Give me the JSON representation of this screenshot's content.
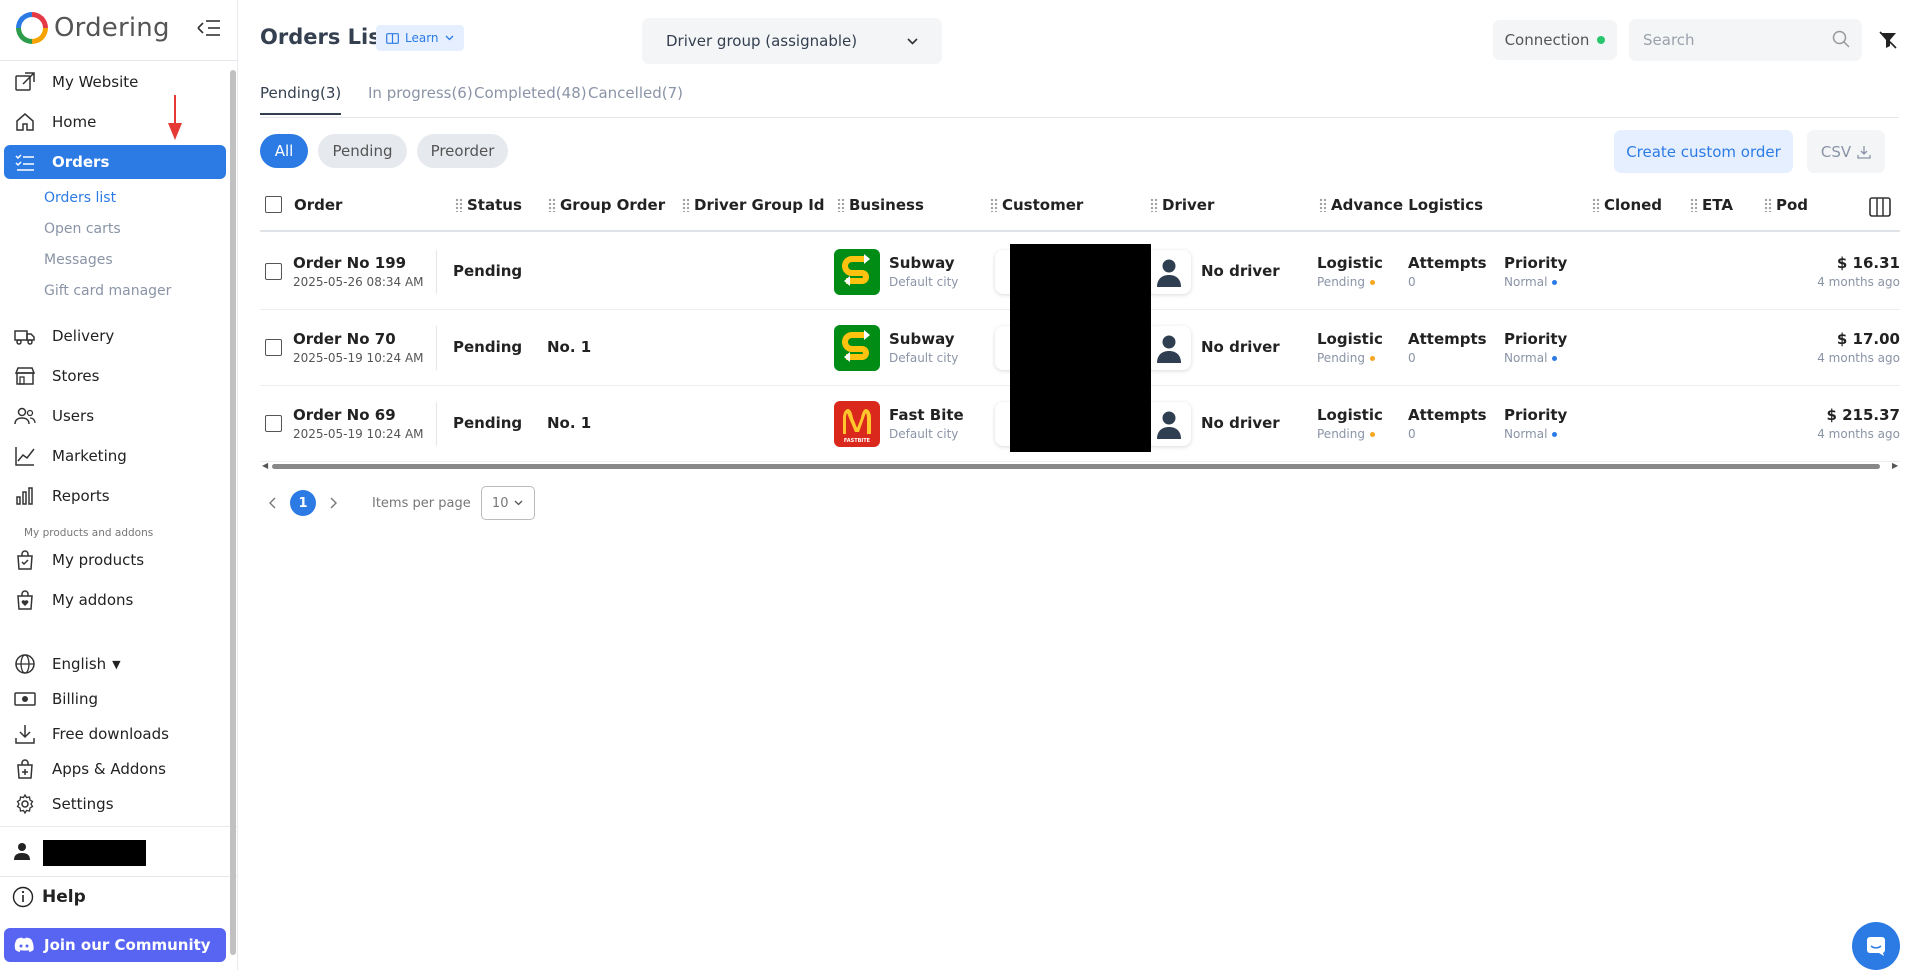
{
  "brand": {
    "name": "Ordering"
  },
  "sidebar": {
    "items": [
      {
        "label": "My Website",
        "icon": "external-link-icon"
      },
      {
        "label": "Home",
        "icon": "home-icon"
      },
      {
        "label": "Orders",
        "icon": "list-icon",
        "active": true
      },
      {
        "label": "Delivery",
        "icon": "truck-icon"
      },
      {
        "label": "Stores",
        "icon": "store-icon"
      },
      {
        "label": "Users",
        "icon": "users-icon"
      },
      {
        "label": "Marketing",
        "icon": "chart-line-icon"
      },
      {
        "label": "Reports",
        "icon": "bar-chart-icon"
      }
    ],
    "sub_items": [
      "Orders list",
      "Open carts",
      "Messages",
      "Gift card manager"
    ],
    "section_label": "My products and addons",
    "product_items": [
      {
        "label": "My products",
        "icon": "bag-check-icon"
      },
      {
        "label": "My addons",
        "icon": "bag-heart-icon"
      }
    ],
    "language": "English",
    "bottom_items": [
      {
        "label": "Billing",
        "icon": "cash-icon"
      },
      {
        "label": "Free downloads",
        "icon": "download-icon"
      },
      {
        "label": "Apps & Addons",
        "icon": "bag-plus-icon"
      },
      {
        "label": "Settings",
        "icon": "gear-icon"
      }
    ],
    "help": "Help",
    "community": "Join our Community"
  },
  "header": {
    "title": "Orders List",
    "learn": "Learn",
    "driver_group": "Driver group (assignable)",
    "connection": "Connection",
    "search_placeholder": "Search"
  },
  "tabs": [
    "Pending(3)",
    "In progress(6)",
    "Completed(48)",
    "Cancelled(7)"
  ],
  "filters": [
    "All",
    "Pending",
    "Preorder"
  ],
  "actions": {
    "create": "Create custom order",
    "csv": "CSV"
  },
  "table": {
    "columns": [
      "Order",
      "Status",
      "Group Order",
      "Driver Group Id",
      "Business",
      "Customer",
      "Driver",
      "Advance Logistics",
      "Cloned",
      "ETA",
      "Pod"
    ],
    "rows": [
      {
        "order": "Order No 199",
        "date": "2025-05-26 08:34 AM",
        "status": "Pending",
        "group": "",
        "business": "Subway",
        "city": "Default city",
        "driver": "No driver",
        "logistic": "Logistic",
        "logistic_status": "Pending",
        "attempts": "Attempts",
        "attempts_count": "0",
        "priority": "Priority",
        "priority_level": "Normal",
        "price": "$ 16.31",
        "ago": "4 months ago",
        "logo": "subway"
      },
      {
        "order": "Order No 70",
        "date": "2025-05-19 10:24 AM",
        "status": "Pending",
        "group": "No. 1",
        "business": "Subway",
        "city": "Default city",
        "driver": "No driver",
        "logistic": "Logistic",
        "logistic_status": "Pending",
        "attempts": "Attempts",
        "attempts_count": "0",
        "priority": "Priority",
        "priority_level": "Normal",
        "price": "$ 17.00",
        "ago": "4 months ago",
        "logo": "subway"
      },
      {
        "order": "Order No 69",
        "date": "2025-05-19 10:24 AM",
        "status": "Pending",
        "group": "No. 1",
        "business": "Fast Bite",
        "city": "Default city",
        "driver": "No driver",
        "logistic": "Logistic",
        "logistic_status": "Pending",
        "attempts": "Attempts",
        "attempts_count": "0",
        "priority": "Priority",
        "priority_level": "Normal",
        "price": "$ 215.37",
        "ago": "4 months ago",
        "logo": "fastbite"
      }
    ]
  },
  "pagination": {
    "current": "1",
    "items_per_page_label": "Items per page",
    "items_per_page": "10"
  },
  "logo_text": {
    "fastbite": "FASTBITE"
  }
}
